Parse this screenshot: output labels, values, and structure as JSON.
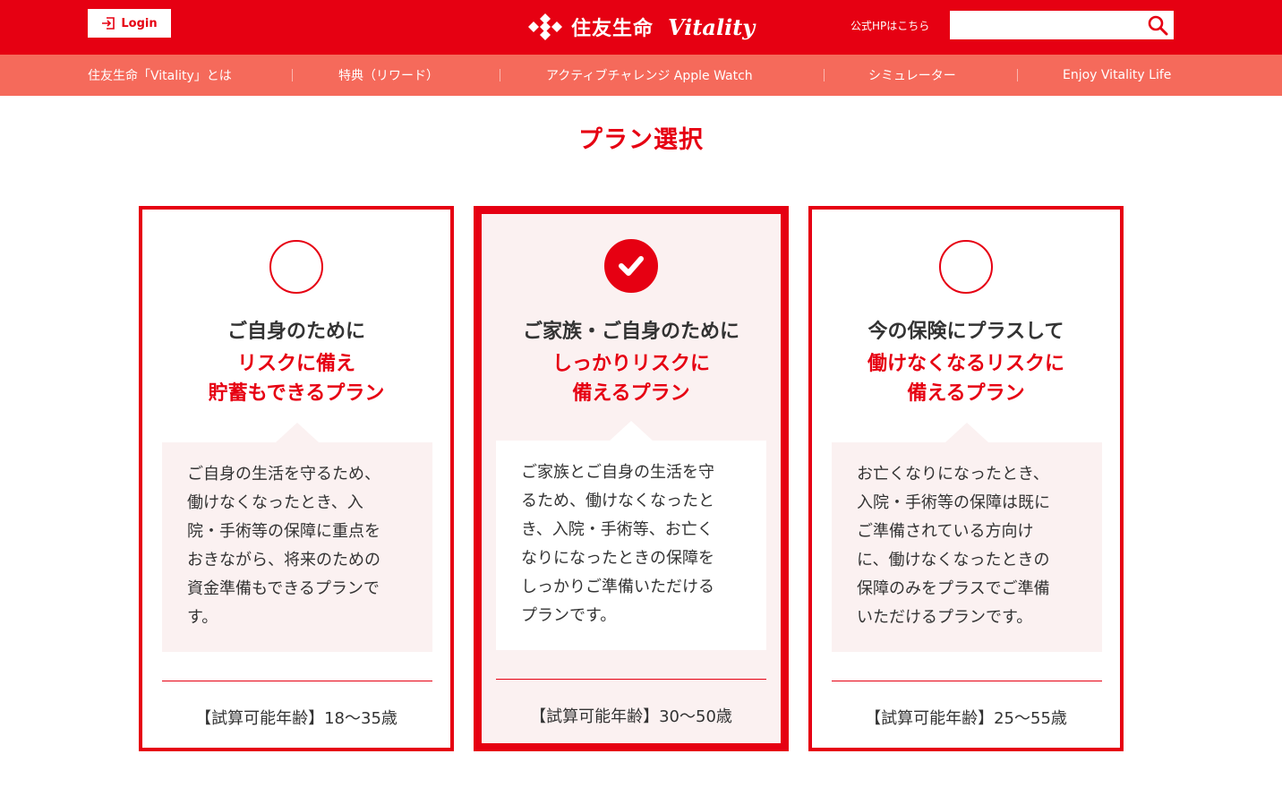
{
  "header": {
    "login_label": "Login",
    "brand_name": "住友生命",
    "brand_sub": "Vitality",
    "official_link": "公式HPはこちら",
    "search_placeholder": "",
    "brand_color": "#e60012"
  },
  "nav": {
    "items": [
      {
        "label": "住友生命「Vitality」とは"
      },
      {
        "label": "特典（リワード）"
      },
      {
        "label": "アクティブチャレンジ Apple Watch"
      },
      {
        "label": "シミュレーター"
      },
      {
        "label": "Enjoy Vitality Life"
      }
    ],
    "color": "#f56a5b"
  },
  "main": {
    "title": "プラン選択",
    "plans": [
      {
        "selected": false,
        "heading": "ご自身のために",
        "sub_line1": "リスクに備え",
        "sub_line2": "貯蓄もできるプラン",
        "description": [
          "ご自身の生活を守るため、",
          "働けなくなったとき、入",
          "院・手術等の保障に重点を",
          "おきながら、将来のための",
          "資金準備もできるプランで",
          "す。"
        ],
        "age": "【試算可能年齢】18〜35歳"
      },
      {
        "selected": true,
        "heading": "ご家族・ご自身のために",
        "sub_line1": "しっかりリスクに",
        "sub_line2": "備えるプラン",
        "description": [
          "ご家族とご自身の生活を守",
          "るため、働けなくなったと",
          "き、入院・手術等、お亡く",
          "なりになったときの保障を",
          "しっかりご準備いただける",
          "プランです。"
        ],
        "age": "【試算可能年齢】30〜50歳"
      },
      {
        "selected": false,
        "heading": "今の保険にプラスして",
        "sub_line1": "働けなくなるリスクに",
        "sub_line2": "備えるプラン",
        "description": [
          "お亡くなりになったとき、",
          "入院・手術等の保障は既に",
          "ご準備されている方向け",
          "に、働けなくなったときの",
          "保障のみをプラスでご準備",
          "いただけるプランです。"
        ],
        "age": "【試算可能年齢】25〜55歳"
      }
    ]
  },
  "icons": {
    "login": "login-icon",
    "brand_mark": "sumitomo-logo-icon",
    "search": "search-icon",
    "radio_selected": "check-icon"
  }
}
